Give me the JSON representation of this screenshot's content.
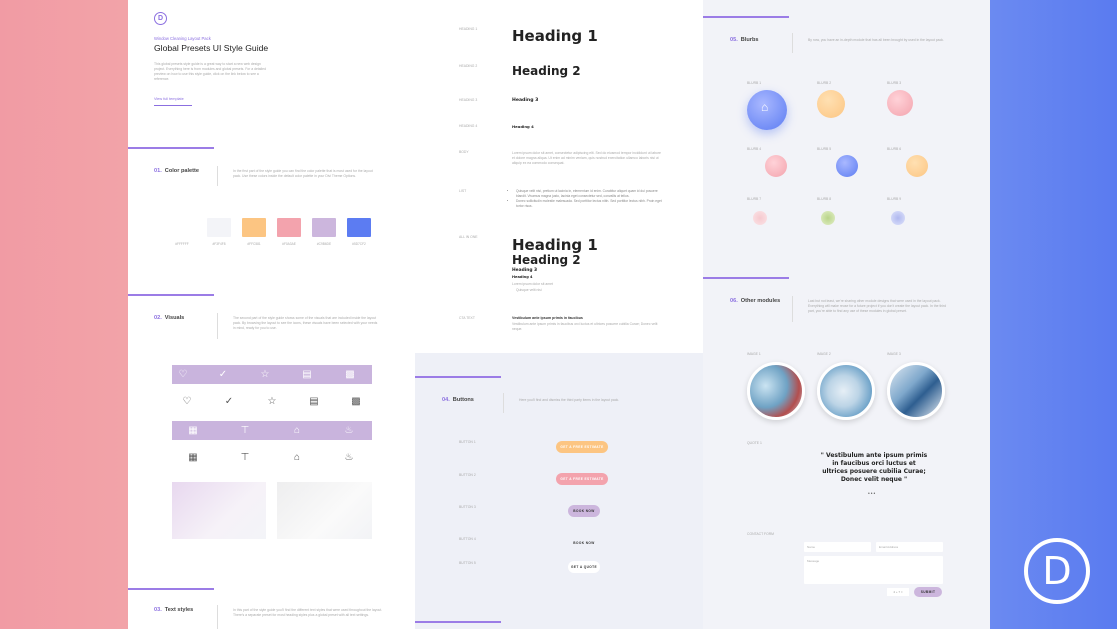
{
  "style_guide": {
    "pack_label": "Window Cleaning Layout Pack",
    "title": "Global Presets UI Style Guide",
    "intro": "This global presets style guide is a great way to start a new web design project. Everything here is from modules and global presets. For a detailed preview on how to use this style guide, click on the link below to see a reference.",
    "link_label": "View full template"
  },
  "sections": {
    "color": {
      "num": "01.",
      "title": "Color palette",
      "desc": "In the first part of the style guide you can find the color palette that is most used for the layout pack. Use these colors inside the default color palette in your Divi Theme Options."
    },
    "visuals": {
      "num": "02.",
      "title": "Visuals",
      "desc": "The second part of the style guide shows some of the visuals that are included inside the layout pack. By browsing the layout to see the icons, these visuals have been selected with your needs in mind, ready for you to use."
    },
    "text": {
      "num": "03.",
      "title": "Text styles",
      "desc": "In this part of the style guide you'll find the different text styles that were used throughout the layout. There's a separate preset for most heading styles plus a global preset with all text settings."
    },
    "buttons": {
      "num": "04.",
      "title": "Buttons",
      "desc": "Here you'll find and dismiss the third party items in the layout pack."
    },
    "blurbs": {
      "num": "05.",
      "title": "Blurbs",
      "desc": "By now, you have an in-depth module that has all been brought by used in the layout pack."
    },
    "other": {
      "num": "06.",
      "title": "Other modules",
      "desc": "Last but not least, we're sharing other module designs that were used in the layout pack. Everything will make reuse for a future project if you don't create the layout pack. In the third part, you're able to find any use of these modules in global preset."
    }
  },
  "palette": [
    {
      "hex": "#ffffff",
      "label": "#FFFFFF"
    },
    {
      "hex": "#f3f4f8",
      "label": "#F3F4F8"
    },
    {
      "hex": "#fcc582",
      "label": "#FFC581"
    },
    {
      "hex": "#f3a3ad",
      "label": "#F0A3AE"
    },
    {
      "hex": "#ccb6dd",
      "label": "#C9B6DE"
    },
    {
      "hex": "#5c7cf2",
      "label": "#5D7CF2"
    }
  ],
  "text_styles": {
    "labels": [
      "HEADING 1",
      "HEADING 2",
      "HEADING 3",
      "HEADING 4",
      "BODY",
      "LIST",
      "ALL IN ONE",
      "CTA TEXT"
    ],
    "h1": "Heading 1",
    "h2": "Heading 2",
    "h3": "Heading 3",
    "h4": "Heading 4",
    "body": "Lorem ipsum dolor sit amet, consectetur adipiscing elit. Sed do eiusmod tempor incididunt ut labore et dolore magna aliqua. Ut enim ad minim veniam, quis nostrud exercitation ullamco laboris nisi ut aliquip ex ea commodo consequat.",
    "list": [
      "Quisque velit nisi, pretium ut lacinia in, elementum id enim. Curabitur aliquet quam id dui posuere blandit. Vivamus magna justo, lacinia eget consectetur sed, convallis at tellus.",
      "Donec sollicitudin molestie malesuada. Sed porttitor lectus nibh. Sed porttitor lectus nibh. Proin eget tortor risus."
    ],
    "combo_h1": "Heading 1",
    "combo_h2": "Heading 2",
    "combo_h3": "Heading 3",
    "combo_h4": "Heading 4",
    "combo_body": "Lorem ipsum dolor sit amet",
    "combo_list": "Quisque velit nisi",
    "cta_title": "Vestibulum ante ipsum primis in faucibus",
    "cta_body": "Vestibulum ante ipsum primis in faucibus orci luctus et ultrices posuere cubilia Curae; Donec velit neque."
  },
  "buttons": {
    "labels": [
      "BUTTON 1",
      "BUTTON 2",
      "BUTTON 3",
      "BUTTON 4",
      "BUTTON 5"
    ],
    "b1": "GET A FREE ESTIMATE",
    "b2": "GET A FREE ESTIMATE",
    "b3": "BOOK NOW",
    "b4": "BOOK NOW",
    "b5": "GET A QUOTE"
  },
  "blurbs": {
    "labels": [
      "BLURB 1",
      "BLURB 2",
      "BLURB 3",
      "BLURB 4",
      "BLURB 5",
      "BLURB 6",
      "BLURB 7",
      "BLURB 8",
      "BLURB 9"
    ]
  },
  "other_modules": {
    "image_labels": [
      "IMAGE 1",
      "IMAGE 2",
      "IMAGE 3"
    ],
    "quote_label": "QUOTE 1",
    "quote": "\" Vestibulum ante ipsum primis in faucibus orci luctus et ultrices posuere cubilia Curae; Donec velit neque \"",
    "form_label": "CONTACT FORM",
    "name_placeholder": "Name",
    "email_placeholder": "Email Address",
    "message_placeholder": "Message",
    "submit": "SUBMIT"
  },
  "brand": {
    "logo_letter": "D"
  }
}
